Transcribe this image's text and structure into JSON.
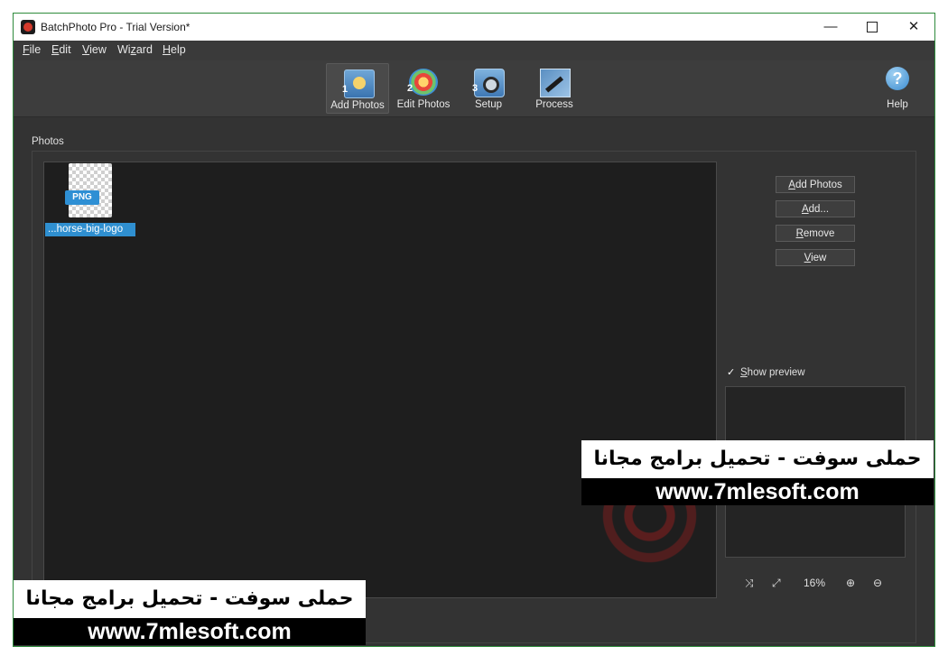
{
  "window": {
    "title": "BatchPhoto Pro - Trial Version*",
    "controls": {
      "minimize": "—",
      "close": "✕"
    }
  },
  "menu": {
    "file": {
      "ul": "F",
      "rest": "ile"
    },
    "edit": {
      "ul": "E",
      "rest": "dit"
    },
    "view": {
      "ul": "V",
      "rest": "iew"
    },
    "wizard": {
      "pre": "Wi",
      "ul": "z",
      "rest": "ard"
    },
    "help": {
      "ul": "H",
      "rest": "elp"
    }
  },
  "toolbar": {
    "steps": [
      {
        "num": "1",
        "label": "Add Photos",
        "icon": "add-photos-icon",
        "active": true
      },
      {
        "num": "2",
        "label": "Edit Photos",
        "icon": "edit-photos-icon",
        "active": false
      },
      {
        "num": "3",
        "label": "Setup",
        "icon": "setup-icon",
        "active": false
      },
      {
        "num": "",
        "label": "Process",
        "icon": "process-icon",
        "active": false
      }
    ],
    "help": {
      "label": "Help",
      "glyph": "?"
    }
  },
  "photos": {
    "group_label": "Photos",
    "items": [
      {
        "badge": "PNG",
        "name": "...horse-big-logo"
      }
    ],
    "buttons": {
      "add_photos": {
        "ul": "A",
        "rest": "dd Photos"
      },
      "add": {
        "ul": "A",
        "rest": "dd..."
      },
      "remove": {
        "ul": "R",
        "rest": "emove"
      },
      "view": {
        "ul": "V",
        "rest": "iew"
      }
    },
    "show_preview": {
      "checked": true,
      "ul": "S",
      "rest": "how preview",
      "check_glyph": "✓"
    },
    "zoom": {
      "level": "16%",
      "fit_icon": "⤨",
      "actual_icon": "⤢",
      "zoom_in": "⊕",
      "zoom_out": "⊖"
    }
  },
  "watermarks": [
    {
      "arabic": "حملى سوفت - تحميل برامج مجانا",
      "url": "www.7mlesoft.com"
    },
    {
      "arabic": "حملى سوفت - تحميل برامج مجانا",
      "url": "www.7mlesoft.com"
    }
  ],
  "colors": {
    "window_bg": "#333333",
    "selection": "#2f8fd0",
    "accent_border": "#2e8b3c"
  }
}
